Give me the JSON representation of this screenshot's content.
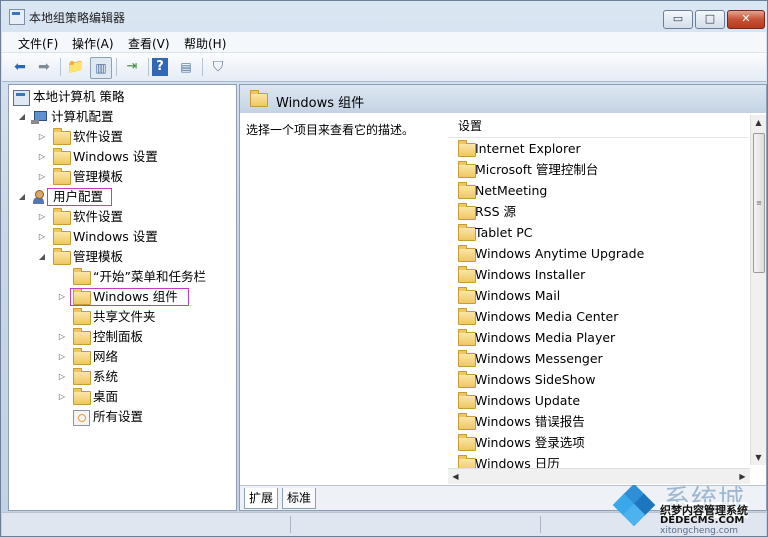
{
  "window": {
    "title": "本地组策略编辑器",
    "controls": {
      "minimize": "▭",
      "maximize": "□",
      "close": "✕"
    }
  },
  "menu": [
    "文件(F)",
    "操作(A)",
    "查看(V)",
    "帮助(H)"
  ],
  "toolbar": {
    "icons": [
      "back-arrow-icon",
      "forward-arrow-icon",
      "up-folder-icon",
      "show-tree-icon",
      "export-list-icon",
      "help-icon",
      "properties-icon",
      "filter-icon"
    ]
  },
  "tree": [
    {
      "label": "本地计算机 策略",
      "icon": "policy-icon",
      "expander": ""
    },
    {
      "label": "计算机配置",
      "icon": "computer-icon",
      "expander": "◢"
    },
    {
      "label": "软件设置",
      "icon": "folder-icon",
      "expander": "▷"
    },
    {
      "label": "Windows 设置",
      "icon": "folder-icon",
      "expander": "▷"
    },
    {
      "label": "管理模板",
      "icon": "folder-icon",
      "expander": "▷"
    },
    {
      "label": "用户配置",
      "icon": "user-icon",
      "expander": "◢",
      "highlighted": true
    },
    {
      "label": "软件设置",
      "icon": "folder-icon",
      "expander": "▷"
    },
    {
      "label": "Windows 设置",
      "icon": "folder-icon",
      "expander": "▷"
    },
    {
      "label": "管理模板",
      "icon": "folder-icon",
      "expander": "◢"
    },
    {
      "label": "“开始”菜单和任务栏",
      "icon": "folder-icon",
      "expander": ""
    },
    {
      "label": "Windows 组件",
      "icon": "folder-icon",
      "expander": "▷",
      "highlighted": true
    },
    {
      "label": "共享文件夹",
      "icon": "folder-icon",
      "expander": ""
    },
    {
      "label": "控制面板",
      "icon": "folder-icon",
      "expander": "▷"
    },
    {
      "label": "网络",
      "icon": "folder-icon",
      "expander": "▷"
    },
    {
      "label": "系统",
      "icon": "folder-icon",
      "expander": "▷"
    },
    {
      "label": "桌面",
      "icon": "folder-icon",
      "expander": "▷"
    },
    {
      "label": "所有设置",
      "icon": "settings-icon",
      "expander": ""
    }
  ],
  "right_panel": {
    "header": "Windows 组件",
    "description": "选择一个项目来查看它的描述。",
    "column_header": "设置",
    "items": [
      "Internet Explorer",
      "Microsoft 管理控制台",
      "NetMeeting",
      "RSS 源",
      "Tablet PC",
      "Windows Anytime Upgrade",
      "Windows Installer",
      "Windows Mail",
      "Windows Media Center",
      "Windows Media Player",
      "Windows Messenger",
      "Windows SideShow",
      "Windows Update",
      "Windows 错误报告",
      "Windows 登录选项",
      "Windows 日历"
    ],
    "tabs": [
      "扩展",
      "标准"
    ]
  },
  "watermark": {
    "big": "系统城",
    "line1": "织梦内容管理系统",
    "line2": "DEDECMS.COM",
    "url": "xitongcheng.com"
  },
  "colors": {
    "highlight_box": "#c43cc2",
    "folder": "#eec763",
    "header_bg": "#c4d3e4"
  }
}
